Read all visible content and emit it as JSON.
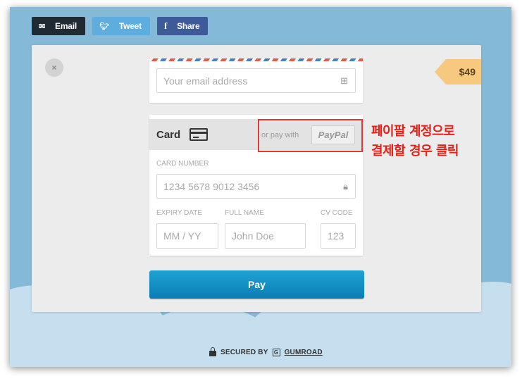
{
  "share": {
    "email": {
      "label": "Email",
      "icon": "envelope-icon"
    },
    "tweet": {
      "label": "Tweet",
      "icon": "twitter-icon"
    },
    "share": {
      "label": "Share",
      "icon": "facebook-icon"
    }
  },
  "checkout": {
    "close_icon": "×",
    "price": "$49",
    "email_placeholder": "Your email address",
    "card_tab": "Card",
    "or_pay_with": "or pay with",
    "paypal_label": "PayPal",
    "card_number_label": "CARD NUMBER",
    "card_number_placeholder": "1234 5678 9012 3456",
    "expiry_label": "EXPIRY DATE",
    "expiry_placeholder": "MM / YY",
    "name_label": "FULL NAME",
    "name_placeholder": "John Doe",
    "cvc_label": "CV CODE",
    "cvc_placeholder": "123",
    "pay_button": "Pay"
  },
  "annotation": {
    "line1": "페이팔 계정으로",
    "line2": "결제할 경우 클릭",
    "color": "#e2231a"
  },
  "footer": {
    "secured_by": "SECURED BY",
    "brand": "GUMROAD"
  },
  "colors": {
    "background": "#84bad8",
    "pay_button": "#0b8ac4",
    "price_tag": "#f7c97e"
  }
}
